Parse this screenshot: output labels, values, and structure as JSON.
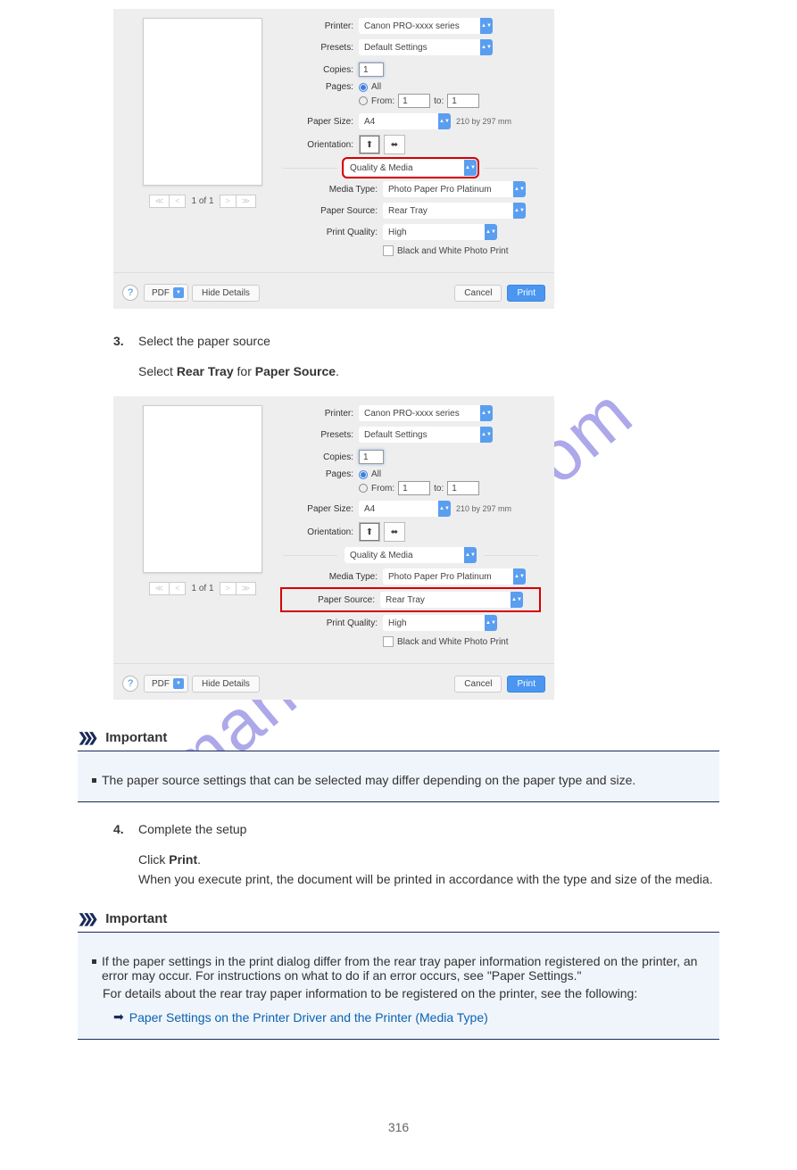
{
  "watermark": "manualshive.com",
  "dialog": {
    "printer_label": "Printer:",
    "printer_value": "Canon PRO-xxxx series",
    "presets_label": "Presets:",
    "presets_value": "Default Settings",
    "copies_label": "Copies:",
    "copies_value": "1",
    "pages_label": "Pages:",
    "pages_all": "All",
    "pages_from_label": "From:",
    "pages_from_value": "1",
    "pages_to_label": "to:",
    "pages_to_value": "1",
    "paper_size_label": "Paper Size:",
    "paper_size_value": "A4",
    "paper_size_dim": "210 by 297 mm",
    "orientation_label": "Orientation:",
    "panel_select_value": "Quality & Media",
    "media_type_label": "Media Type:",
    "media_type_value": "Photo Paper Pro Platinum",
    "paper_source_label": "Paper Source:",
    "paper_source_value": "Rear Tray",
    "print_quality_label": "Print Quality:",
    "print_quality_value": "High",
    "bw_label": "Black and White Photo Print",
    "preview_page_of": "1 of 1",
    "help_q": "?",
    "pdf_label": "PDF",
    "hide_details": "Hide Details",
    "cancel": "Cancel",
    "print": "Print"
  },
  "steps": {
    "s3_num": "3.",
    "s3_text": "Select the paper source",
    "s3_desc_a": "Select ",
    "s3_desc_b": "Rear Tray",
    "s3_desc_c": " for ",
    "s3_desc_d": "Paper Source",
    "s3_desc_e": "."
  },
  "important": {
    "header": "Important",
    "bullet_text": "The paper source settings that can be selected may differ depending on the paper type and size.",
    "s4_num": "4.",
    "s4_text": "Complete the setup",
    "s4_body_a": "Click ",
    "s4_body_b": "Print",
    "s4_body_c": ".",
    "s4_body_d": "When you execute print, the document will be printed in accordance with the type and size of the media.",
    "bullet2_text": "If the paper settings in the print dialog differ from the rear tray paper information registered on the printer, an error may occur. For instructions on what to do if an error occurs, see \"Paper Settings.\"",
    "bullet2_text2": "For details about the rear tray paper information to be registered on the printer, see the following:",
    "link_text": "Paper Settings on the Printer Driver and the Printer (Media Type)"
  },
  "page_number": "316"
}
